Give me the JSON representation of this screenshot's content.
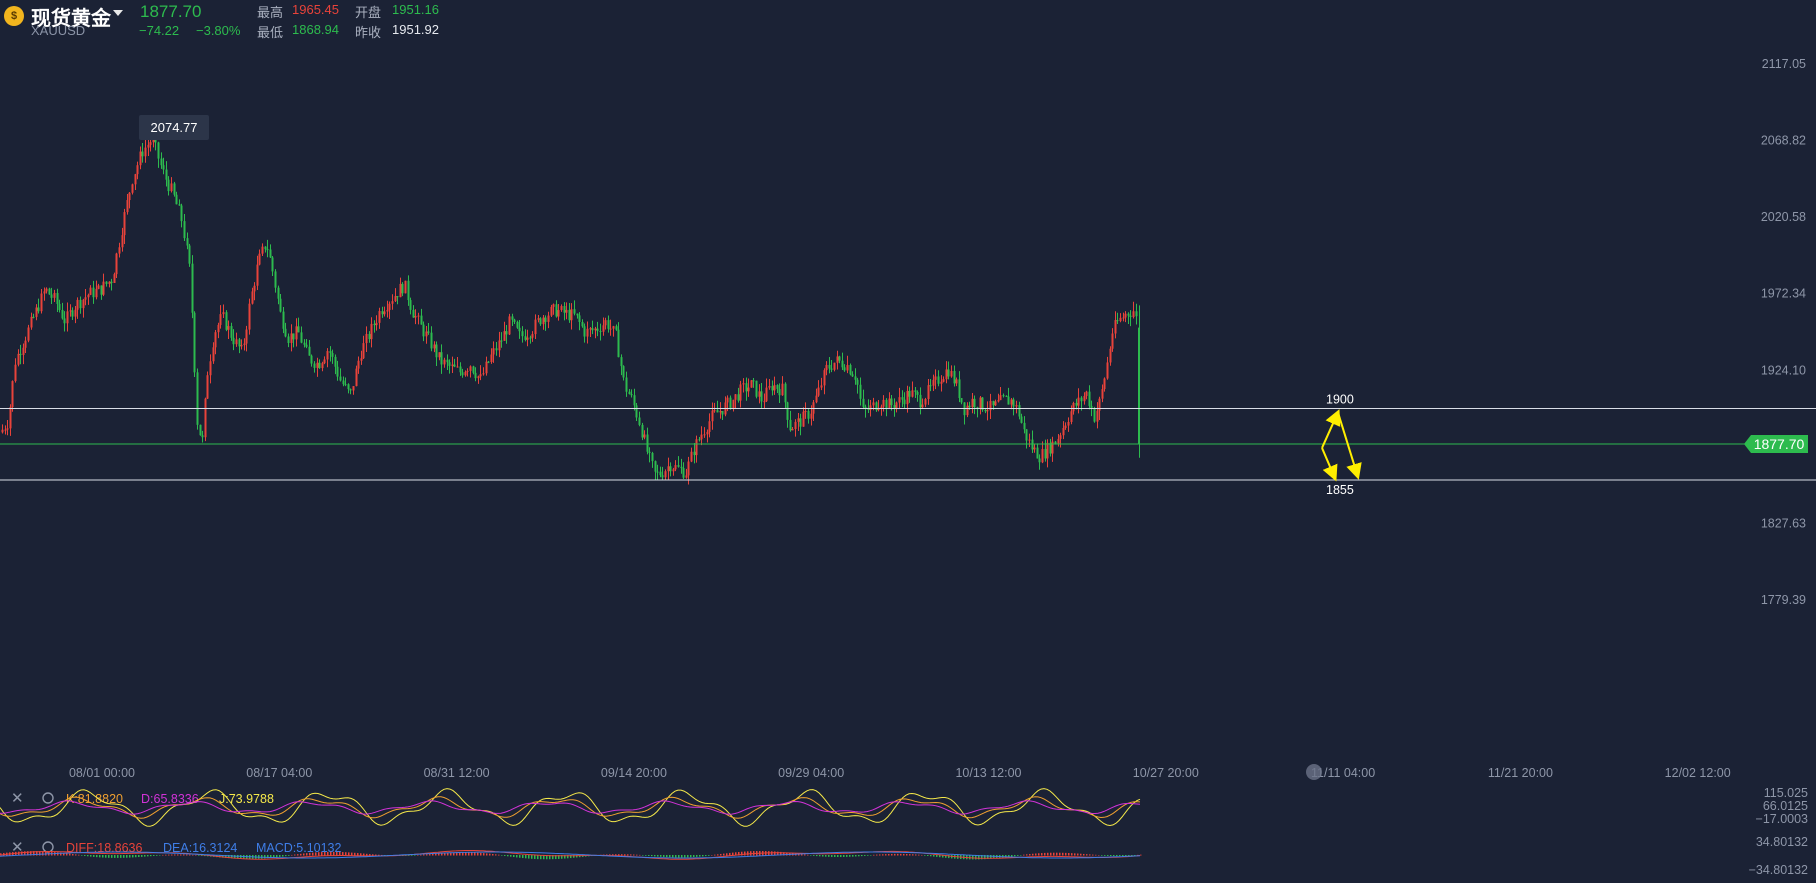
{
  "header": {
    "symbol_name": "现货黄金",
    "symbol_code": "XAUUSD",
    "price": "1877.70",
    "change": "−74.22",
    "change_pct": "−3.80%",
    "high_label": "最高",
    "high_value": "1965.45",
    "open_label": "开盘",
    "open_value": "1951.16",
    "low_label": "最低",
    "low_value": "1868.94",
    "prev_close_label": "昨收",
    "prev_close_value": "1951.92"
  },
  "colors": {
    "up": "#e8433a",
    "down": "#2dbb4e",
    "background": "#1b2235",
    "k_line": "#f0a030",
    "d_line": "#d233d8",
    "j_line": "#f5e94a",
    "diff_line": "#e8433a",
    "dea_line": "#3f7ee8",
    "arrow": "#ffee00"
  },
  "chart_data": {
    "type": "candlestick",
    "y_ticks": [
      "2117.05",
      "2068.82",
      "2020.58",
      "1972.34",
      "1924.10",
      "1827.63",
      "1779.39"
    ],
    "x_ticks": [
      "08/01 00:00",
      "08/17 04:00",
      "08/31 12:00",
      "09/14 20:00",
      "09/29 04:00",
      "10/13 12:00",
      "10/27 20:00",
      "11/11 04:00",
      "11/21 20:00",
      "12/02 12:00"
    ],
    "ylim": [
      1760,
      2135
    ],
    "high_marker": "2074.77",
    "current_price": "1877.70",
    "current_price_value": 1877.7,
    "levels": [
      {
        "label": "1900",
        "value": 1900
      },
      {
        "label": "1855",
        "value": 1855
      }
    ],
    "path_anchors": [
      [
        0,
        1885
      ],
      [
        8,
        1892
      ],
      [
        15,
        1930
      ],
      [
        25,
        1945
      ],
      [
        35,
        1960
      ],
      [
        45,
        1975
      ],
      [
        55,
        1968
      ],
      [
        65,
        1955
      ],
      [
        75,
        1965
      ],
      [
        88,
        1972
      ],
      [
        100,
        1975
      ],
      [
        112,
        1982
      ],
      [
        122,
        2015
      ],
      [
        132,
        2045
      ],
      [
        142,
        2062
      ],
      [
        152,
        2070
      ],
      [
        162,
        2050
      ],
      [
        172,
        2036
      ],
      [
        182,
        2018
      ],
      [
        190,
        1985
      ],
      [
        197,
        1892
      ],
      [
        202,
        1878
      ],
      [
        207,
        1922
      ],
      [
        214,
        1948
      ],
      [
        222,
        1958
      ],
      [
        232,
        1945
      ],
      [
        242,
        1935
      ],
      [
        250,
        1968
      ],
      [
        258,
        1992
      ],
      [
        266,
        2005
      ],
      [
        273,
        1985
      ],
      [
        280,
        1960
      ],
      [
        288,
        1945
      ],
      [
        298,
        1948
      ],
      [
        308,
        1932
      ],
      [
        318,
        1928
      ],
      [
        328,
        1938
      ],
      [
        340,
        1918
      ],
      [
        350,
        1908
      ],
      [
        360,
        1935
      ],
      [
        370,
        1948
      ],
      [
        380,
        1962
      ],
      [
        392,
        1970
      ],
      [
        404,
        1978
      ],
      [
        412,
        1962
      ],
      [
        420,
        1952
      ],
      [
        430,
        1942
      ],
      [
        440,
        1930
      ],
      [
        450,
        1926
      ],
      [
        460,
        1923
      ],
      [
        470,
        1928
      ],
      [
        480,
        1918
      ],
      [
        490,
        1932
      ],
      [
        500,
        1942
      ],
      [
        510,
        1955
      ],
      [
        520,
        1945
      ],
      [
        532,
        1950
      ],
      [
        542,
        1958
      ],
      [
        555,
        1962
      ],
      [
        565,
        1960
      ],
      [
        575,
        1958
      ],
      [
        585,
        1948
      ],
      [
        596,
        1950
      ],
      [
        606,
        1955
      ],
      [
        616,
        1945
      ],
      [
        624,
        1915
      ],
      [
        632,
        1905
      ],
      [
        640,
        1890
      ],
      [
        648,
        1870
      ],
      [
        655,
        1858
      ],
      [
        662,
        1860
      ],
      [
        670,
        1865
      ],
      [
        678,
        1862
      ],
      [
        686,
        1860
      ],
      [
        694,
        1875
      ],
      [
        702,
        1885
      ],
      [
        712,
        1895
      ],
      [
        722,
        1900
      ],
      [
        732,
        1905
      ],
      [
        742,
        1912
      ],
      [
        752,
        1915
      ],
      [
        762,
        1905
      ],
      [
        772,
        1915
      ],
      [
        782,
        1912
      ],
      [
        790,
        1888
      ],
      [
        800,
        1892
      ],
      [
        810,
        1898
      ],
      [
        818,
        1910
      ],
      [
        826,
        1925
      ],
      [
        836,
        1930
      ],
      [
        846,
        1928
      ],
      [
        856,
        1920
      ],
      [
        862,
        1898
      ],
      [
        870,
        1900
      ],
      [
        880,
        1905
      ],
      [
        890,
        1902
      ],
      [
        900,
        1905
      ],
      [
        910,
        1910
      ],
      [
        920,
        1905
      ],
      [
        930,
        1912
      ],
      [
        940,
        1920
      ],
      [
        948,
        1925
      ],
      [
        956,
        1915
      ],
      [
        964,
        1900
      ],
      [
        972,
        1905
      ],
      [
        982,
        1902
      ],
      [
        992,
        1900
      ],
      [
        1002,
        1905
      ],
      [
        1012,
        1905
      ],
      [
        1018,
        1898
      ],
      [
        1024,
        1885
      ],
      [
        1032,
        1875
      ],
      [
        1040,
        1870
      ],
      [
        1048,
        1875
      ],
      [
        1056,
        1880
      ],
      [
        1064,
        1890
      ],
      [
        1072,
        1900
      ],
      [
        1080,
        1905
      ],
      [
        1086,
        1910
      ],
      [
        1094,
        1895
      ],
      [
        1100,
        1905
      ],
      [
        1106,
        1925
      ],
      [
        1112,
        1948
      ],
      [
        1118,
        1955
      ],
      [
        1126,
        1960
      ],
      [
        1134,
        1962
      ],
      [
        1138,
        1948
      ],
      [
        1140,
        1877.7
      ]
    ]
  },
  "indicators": {
    "kdj": {
      "k_label": "K:81.8820",
      "d_label": "D:65.8336",
      "j_label": "J:73.9788",
      "axis": [
        "115.025",
        "66.0125",
        "−17.0003"
      ]
    },
    "macd": {
      "diff_label": "DIFF:18.8636",
      "dea_label": "DEA:16.3124",
      "macd_label": "MACD:5.10132",
      "axis": [
        "34.80132",
        "−34.80132"
      ]
    }
  }
}
